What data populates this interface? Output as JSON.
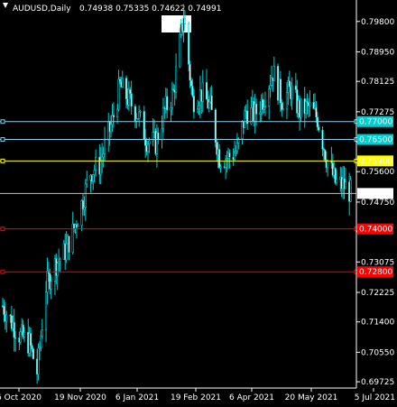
{
  "window": {
    "symbol_label": "AUDUSD,Daily",
    "ohlc": "0.74938 0.75335 0.74622 0.74991",
    "arrow": "▼"
  },
  "chart_data": {
    "type": "candlestick",
    "symbol": "AUDUSD",
    "timeframe": "Daily",
    "ylim": [
      0.6955,
      0.804
    ],
    "y_ticks": [
      "0.79800",
      "0.78950",
      "0.78125",
      "0.77275",
      "0.76425",
      "0.75600",
      "0.74750",
      "0.73925",
      "0.73075",
      "0.72225",
      "0.71400",
      "0.70550",
      "0.69725"
    ],
    "x_ticks": [
      "6 Oct 2020",
      "19 Nov 2020",
      "6 Jan 2021",
      "19 Feb 2021",
      "6 Apr 2021",
      "20 May 2021",
      "5 Jul 2021"
    ],
    "x_range": [
      "2020-10-06",
      "2021-07-07"
    ],
    "current_price": "0.74991",
    "price_path": [
      [
        "2020-10-06",
        0.7185
      ],
      [
        "2020-10-13",
        0.714
      ],
      [
        "2020-10-20",
        0.71
      ],
      [
        "2020-10-27",
        0.708
      ],
      [
        "2020-11-02",
        0.7
      ],
      [
        "2020-11-09",
        0.724
      ],
      [
        "2020-11-16",
        0.73
      ],
      [
        "2020-11-23",
        0.733
      ],
      [
        "2020-11-30",
        0.739
      ],
      [
        "2020-12-07",
        0.747
      ],
      [
        "2020-12-14",
        0.756
      ],
      [
        "2020-12-21",
        0.758
      ],
      [
        "2020-12-31",
        0.77
      ],
      [
        "2021-01-06",
        0.78
      ],
      [
        "2021-01-13",
        0.776
      ],
      [
        "2021-01-20",
        0.772
      ],
      [
        "2021-01-27",
        0.765
      ],
      [
        "2021-02-03",
        0.764
      ],
      [
        "2021-02-10",
        0.773
      ],
      [
        "2021-02-17",
        0.778
      ],
      [
        "2021-02-25",
        0.8
      ],
      [
        "2021-03-04",
        0.776
      ],
      [
        "2021-03-11",
        0.778
      ],
      [
        "2021-03-18",
        0.774
      ],
      [
        "2021-03-25",
        0.76
      ],
      [
        "2021-04-01",
        0.76
      ],
      [
        "2021-04-08",
        0.762
      ],
      [
        "2021-04-15",
        0.773
      ],
      [
        "2021-04-22",
        0.772
      ],
      [
        "2021-04-29",
        0.777
      ],
      [
        "2021-05-06",
        0.784
      ],
      [
        "2021-05-13",
        0.776
      ],
      [
        "2021-05-20",
        0.779
      ],
      [
        "2021-05-27",
        0.773
      ],
      [
        "2021-06-03",
        0.774
      ],
      [
        "2021-06-10",
        0.771
      ],
      [
        "2021-06-17",
        0.76
      ],
      [
        "2021-06-24",
        0.753
      ],
      [
        "2021-07-01",
        0.752
      ],
      [
        "2021-07-07",
        0.7499
      ]
    ],
    "volatility": 0.0045,
    "levels": [
      {
        "price": "0.77000",
        "color": "#87ceeb",
        "label_bg": "#00ced1",
        "label_color": "#000000"
      },
      {
        "price": "0.76500",
        "color": "#87ceeb",
        "label_bg": "#00ced1",
        "label_color": "#000000"
      },
      {
        "price": "0.75900",
        "color": "#ffff00",
        "label_bg": "#ffff00",
        "label_color": "#000000"
      },
      {
        "price": "0.74000",
        "color": "#ff0000",
        "label_bg": "#ff0000",
        "label_color": "#000000"
      },
      {
        "price": "0.72800",
        "color": "#ff0000",
        "label_bg": "#ff0000",
        "label_color": "#000000"
      }
    ],
    "colors": {
      "background": "#000000",
      "candle": "#00ced1",
      "axis": "#ffffff",
      "current_line": "#c0c0c0"
    }
  }
}
